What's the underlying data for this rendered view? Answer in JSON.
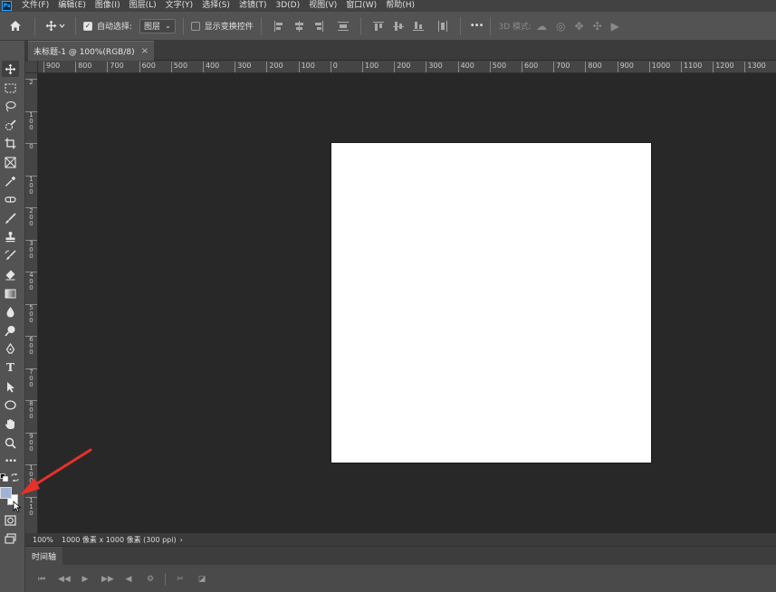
{
  "app": {
    "logo": "Ps"
  },
  "menubar": {
    "items": [
      "文件(F)",
      "编辑(E)",
      "图像(I)",
      "图层(L)",
      "文字(Y)",
      "选择(S)",
      "滤镜(T)",
      "3D(D)",
      "视图(V)",
      "窗口(W)",
      "帮助(H)"
    ]
  },
  "options": {
    "auto_select_label": "自动选择:",
    "auto_select_checked": true,
    "layer_select_value": "图层",
    "show_transform_label": "显示变换控件",
    "show_transform_checked": false,
    "more_label": "•••",
    "mode3d_label": "3D 模式:"
  },
  "tab": {
    "title": "未标题-1 @ 100%(RGB/8)",
    "close": "×"
  },
  "ruler_top": [
    "900",
    "800",
    "700",
    "600",
    "500",
    "400",
    "300",
    "200",
    "100",
    "0",
    "100",
    "200",
    "300",
    "400",
    "500",
    "600",
    "700",
    "800",
    "900",
    "1000",
    "1100",
    "1200",
    "1300"
  ],
  "ruler_left": [
    "2",
    "1 0 0",
    "0",
    "1 0 0",
    "2 0 0",
    "3 0 0",
    "4 0 0",
    "5 0 0",
    "6 0 0",
    "7 0 0",
    "8 0 0",
    "9 0 0",
    "1 0 0 0",
    "1 1 0"
  ],
  "toolbar": {
    "tools": [
      {
        "name": "move-tool",
        "glyph": "✥"
      },
      {
        "name": "marquee-tool",
        "glyph": "⬚"
      },
      {
        "name": "lasso-tool",
        "glyph": "ℓ"
      },
      {
        "name": "quick-select-tool",
        "glyph": "✎"
      },
      {
        "name": "crop-tool",
        "glyph": "⌗"
      },
      {
        "name": "frame-tool",
        "glyph": "⊠"
      },
      {
        "name": "eyedropper-tool",
        "glyph": "⁄"
      },
      {
        "name": "healing-brush-tool",
        "glyph": "⊕"
      },
      {
        "name": "brush-tool",
        "glyph": "✐"
      },
      {
        "name": "clone-stamp-tool",
        "glyph": "⊥"
      },
      {
        "name": "history-brush-tool",
        "glyph": "↺"
      },
      {
        "name": "eraser-tool",
        "glyph": "◇"
      },
      {
        "name": "gradient-tool",
        "glyph": "▣"
      },
      {
        "name": "blur-tool",
        "glyph": "●"
      },
      {
        "name": "dodge-tool",
        "glyph": "◔"
      },
      {
        "name": "pen-tool",
        "glyph": "✒"
      },
      {
        "name": "type-tool",
        "glyph": "T"
      },
      {
        "name": "path-select-tool",
        "glyph": "➤"
      },
      {
        "name": "ellipse-tool",
        "glyph": "○"
      },
      {
        "name": "hand-tool",
        "glyph": "✋"
      },
      {
        "name": "zoom-tool",
        "glyph": "⌕"
      },
      {
        "name": "edit-toolbar",
        "glyph": "•••"
      }
    ],
    "foreground_color": "#9fb3d6",
    "background_color": "#ffffff",
    "quick_mask_glyph": "◎",
    "screen_mode_glyph": "▭"
  },
  "canvas": {
    "document_color": "#ffffff",
    "pasteboard_color": "#282828"
  },
  "status": {
    "zoom": "100%",
    "doc_info": "1000 像素 x 1000 像素 (300 ppi)",
    "arrow": "›"
  },
  "timeline": {
    "tab_label": "时间轴"
  },
  "annotation": {
    "arrow_color": "#e8302a"
  }
}
